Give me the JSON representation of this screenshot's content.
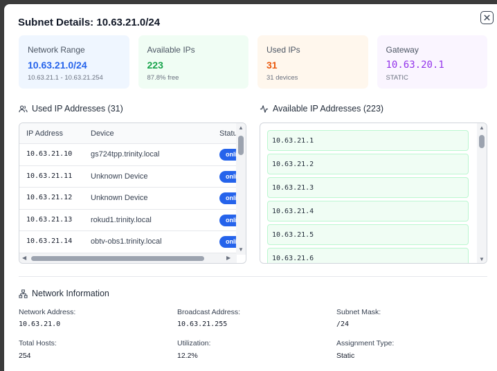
{
  "title": "Subnet Details: 10.63.21.0/24",
  "cards": [
    {
      "label": "Network Range",
      "value": "10.63.21.0/24",
      "sub": "10.63.21.1 - 10.63.21.254"
    },
    {
      "label": "Available IPs",
      "value": "223",
      "sub": "87.8% free"
    },
    {
      "label": "Used IPs",
      "value": "31",
      "sub": "31 devices"
    },
    {
      "label": "Gateway",
      "value": "10.63.20.1",
      "sub": "STATIC"
    }
  ],
  "used": {
    "heading": "Used IP Addresses (31)",
    "columns": [
      "IP Address",
      "Device",
      "Status"
    ],
    "rows": [
      {
        "ip": "10.63.21.10",
        "device": "gs724tpp.trinity.local",
        "status": "online"
      },
      {
        "ip": "10.63.21.11",
        "device": "Unknown Device",
        "status": "online"
      },
      {
        "ip": "10.63.21.12",
        "device": "Unknown Device",
        "status": "online"
      },
      {
        "ip": "10.63.21.13",
        "device": "rokud1.trinity.local",
        "status": "online"
      },
      {
        "ip": "10.63.21.14",
        "device": "obtv-obs1.trinity.local",
        "status": "online"
      }
    ]
  },
  "available": {
    "heading": "Available IP Addresses (223)",
    "items": [
      "10.63.21.1",
      "10.63.21.2",
      "10.63.21.3",
      "10.63.21.4",
      "10.63.21.5",
      "10.63.21.6"
    ]
  },
  "network_info": {
    "heading": "Network Information",
    "fields": [
      {
        "label": "Network Address:",
        "value": "10.63.21.0"
      },
      {
        "label": "Broadcast Address:",
        "value": "10.63.21.255"
      },
      {
        "label": "Subnet Mask:",
        "value": "/24"
      },
      {
        "label": "Total Hosts:",
        "value": "254"
      },
      {
        "label": "Utilization:",
        "value": "12.2%"
      },
      {
        "label": "Assignment Type:",
        "value": "Static"
      }
    ]
  }
}
